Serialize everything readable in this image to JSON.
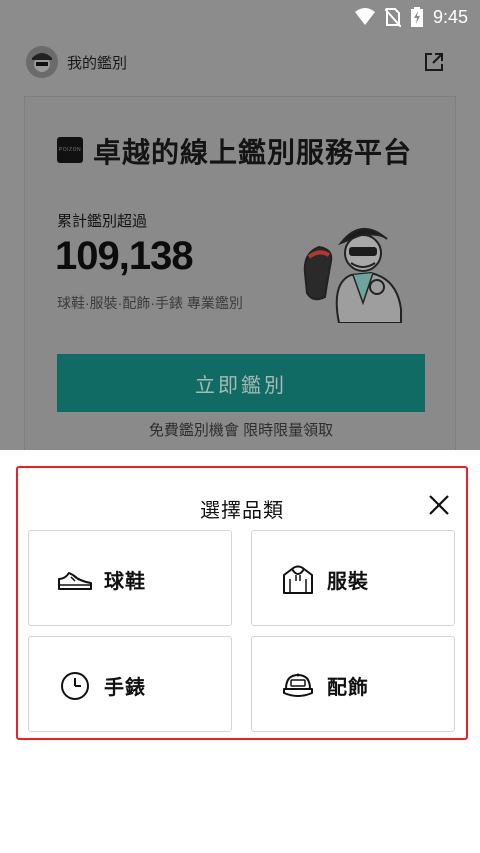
{
  "status_bar": {
    "time": "9:45"
  },
  "header": {
    "title": "我的鑑別"
  },
  "hero": {
    "logo_text": "POIZON",
    "title": "卓越的線上鑑別服務平台",
    "count_label": "累計鑑別超過",
    "count_value": "109,138",
    "categories_line": "球鞋·服裝·配飾·手錶 專業鑑別",
    "cta_label": "立即鑑別",
    "cta_subtext": "免費鑑別機會 限時限量領取"
  },
  "sheet": {
    "title": "選擇品類",
    "categories": [
      {
        "label": "球鞋",
        "icon": "sneaker-icon"
      },
      {
        "label": "服裝",
        "icon": "hoodie-icon"
      },
      {
        "label": "手錶",
        "icon": "clock-icon"
      },
      {
        "label": "配飾",
        "icon": "cap-icon"
      }
    ]
  },
  "colors": {
    "overlay_gray": "#8c8c8c",
    "cta_teal": "#0f6b63",
    "highlight_red": "#e8202a"
  }
}
